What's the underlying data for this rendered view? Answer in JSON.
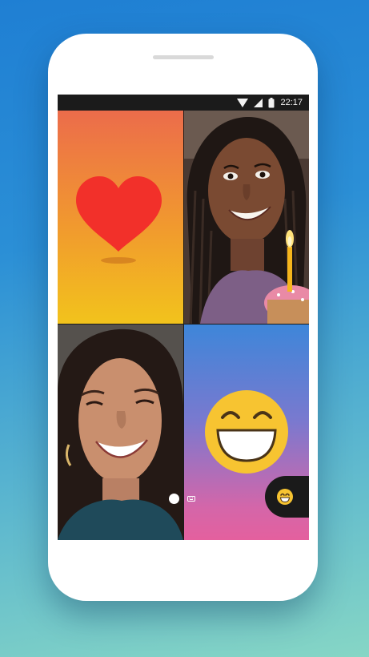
{
  "status_bar": {
    "time": "22:17",
    "icons": [
      "wifi-icon",
      "signal-icon",
      "battery-icon"
    ]
  },
  "call_grid": {
    "tiles": [
      {
        "type": "reaction",
        "icon": "heart-icon",
        "colors": [
          "#ec6c4b",
          "#f2c31c"
        ]
      },
      {
        "type": "video",
        "content": "participant-video"
      },
      {
        "type": "video",
        "content": "participant-video"
      },
      {
        "type": "reaction",
        "icon": "grinning-emoji-icon",
        "colors": [
          "#3e86d9",
          "#e4609e"
        ]
      }
    ]
  },
  "reaction_button": {
    "icon": "emoji-icon"
  },
  "colors": {
    "background_top": "#1f7fd3",
    "background_bottom": "#86d6c5",
    "heart": "#f2302a",
    "emoji": "#f7c431"
  }
}
